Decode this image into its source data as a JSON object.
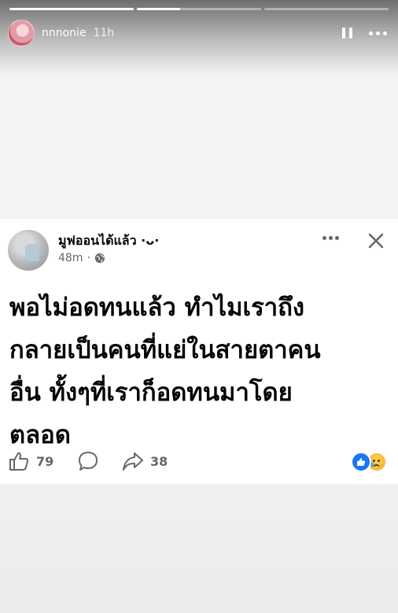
{
  "story": {
    "username": "nnnonie",
    "time_ago": "11h",
    "progress": [
      1.0,
      0.35,
      0.0
    ]
  },
  "post": {
    "page_name": "มูฟออนได้แล้ว ·ᴗ·",
    "time_ago": "48m",
    "separator": "·",
    "text_lines": [
      "พอไม่อดทนแล้ว ทำไมเราถึง",
      "กลายเป็นคนที่แย่ในสายตาคน",
      "อื่น ทั้งๆที่เราก็อดทนมาโดย",
      "ตลอด"
    ],
    "likes_count": "79",
    "shares_count": "38",
    "reaction_types": [
      "like",
      "sad"
    ]
  },
  "colors": {
    "accent": "#1877f2",
    "text_primary": "#050505",
    "text_secondary": "#65676b"
  },
  "icons": [
    "pause-icon",
    "more-icon",
    "globe-icon",
    "close-icon",
    "like-icon",
    "comment-icon",
    "share-icon"
  ]
}
